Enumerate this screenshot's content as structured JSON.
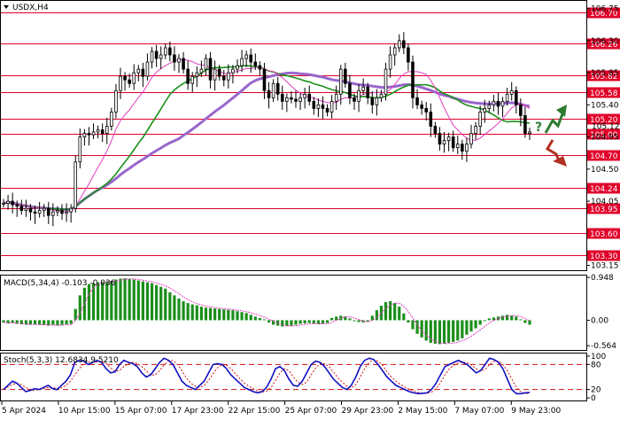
{
  "title": "USDX,H4",
  "chart_data": [
    {
      "panel": "price",
      "type": "candlestick",
      "symbol": "USDX",
      "timeframe": "H4",
      "ylim": [
        103.12,
        106.82
      ],
      "y_ticks": [
        103.15,
        104.05,
        104.5,
        104.95,
        105.4,
        105.85,
        106.3,
        106.75
      ],
      "price_axis_label": "105.12",
      "levels": [
        {
          "value": 106.7,
          "label": "106.70",
          "color": "#e0002a"
        },
        {
          "value": 106.26,
          "label": "106.26",
          "color": "#e0002a"
        },
        {
          "value": 105.82,
          "label": "105.82",
          "color": "#e0002a"
        },
        {
          "value": 105.58,
          "label": "105.58",
          "color": "#e0002a"
        },
        {
          "value": 105.2,
          "label": "105.20",
          "color": "#e0002a"
        },
        {
          "value": 105.0,
          "label": "105.00",
          "color": "#e0002a"
        },
        {
          "value": 104.7,
          "label": "104.70",
          "color": "#e0002a"
        },
        {
          "value": 104.24,
          "label": "104.24",
          "color": "#e0002a"
        },
        {
          "value": 103.95,
          "label": "103.95",
          "color": "#e0002a"
        },
        {
          "value": 103.6,
          "label": "103.60",
          "color": "#e0002a"
        },
        {
          "value": 103.3,
          "label": "103.30",
          "color": "#e0002a"
        }
      ],
      "close_series": [
        104.02,
        104.05,
        104.0,
        103.98,
        103.92,
        103.95,
        103.9,
        103.88,
        103.92,
        103.95,
        103.85,
        103.9,
        103.92,
        103.88,
        103.9,
        103.95,
        104.6,
        104.95,
        105.0,
        104.98,
        105.02,
        105.05,
        105.0,
        105.1,
        105.3,
        105.6,
        105.8,
        105.75,
        105.7,
        105.85,
        105.9,
        105.8,
        106.0,
        106.15,
        106.05,
        106.1,
        106.2,
        106.1,
        106.0,
        106.05,
        105.9,
        105.7,
        105.8,
        105.85,
        105.9,
        106.05,
        105.75,
        105.9,
        105.8,
        105.75,
        105.85,
        105.9,
        105.95,
        106.05,
        106.1,
        106.0,
        105.95,
        105.9,
        105.6,
        105.5,
        105.7,
        105.55,
        105.45,
        105.5,
        105.48,
        105.45,
        105.5,
        105.55,
        105.45,
        105.35,
        105.4,
        105.35,
        105.3,
        105.45,
        105.55,
        105.9,
        105.7,
        105.5,
        105.45,
        105.6,
        105.65,
        105.5,
        105.4,
        105.5,
        105.55,
        105.9,
        106.1,
        106.2,
        106.3,
        106.2,
        106.0,
        105.5,
        105.4,
        105.35,
        105.3,
        105.1,
        105.0,
        104.85,
        104.9,
        104.95,
        104.8,
        104.85,
        104.75,
        104.85,
        105.0,
        105.1,
        105.3,
        105.35,
        105.4,
        105.45,
        105.38,
        105.45,
        105.55,
        105.6,
        105.4,
        105.25,
        105.0,
        105.02
      ],
      "moving_averages": [
        {
          "color": "#9966cc"
        },
        {
          "color": "#1a8f1a"
        },
        {
          "color": "#e040c0"
        }
      ],
      "annotation_up_color": "#2e7d32",
      "annotation_down_color": "#b03020",
      "annotation_question": "?"
    },
    {
      "panel": "macd",
      "type": "bar",
      "label": "MACD(5,34,4) -0.103 -0.036",
      "ylim": [
        -0.6,
        0.95
      ],
      "y_ticks": [
        0.948,
        0.0,
        -0.564
      ],
      "bar_color": "#1a8f1a",
      "signal_color": "#e040c0",
      "values": [
        -0.05,
        -0.07,
        -0.06,
        -0.08,
        -0.09,
        -0.1,
        -0.1,
        -0.09,
        -0.1,
        -0.11,
        -0.12,
        -0.1,
        -0.12,
        -0.1,
        -0.09,
        -0.08,
        0.25,
        0.55,
        0.72,
        0.8,
        0.82,
        0.84,
        0.85,
        0.86,
        0.87,
        0.9,
        0.92,
        0.93,
        0.91,
        0.9,
        0.88,
        0.86,
        0.84,
        0.82,
        0.78,
        0.74,
        0.7,
        0.62,
        0.55,
        0.48,
        0.42,
        0.38,
        0.35,
        0.33,
        0.3,
        0.28,
        0.27,
        0.26,
        0.25,
        0.24,
        0.23,
        0.22,
        0.2,
        0.18,
        0.16,
        0.12,
        0.08,
        0.05,
        0.02,
        -0.05,
        -0.1,
        -0.12,
        -0.14,
        -0.13,
        -0.12,
        -0.1,
        -0.08,
        -0.07,
        -0.06,
        -0.08,
        -0.09,
        -0.08,
        -0.06,
        0.05,
        0.08,
        0.1,
        0.08,
        0.04,
        -0.02,
        -0.04,
        -0.05,
        -0.03,
        0.1,
        0.22,
        0.32,
        0.4,
        0.42,
        0.38,
        0.3,
        0.15,
        -0.05,
        -0.2,
        -0.3,
        -0.38,
        -0.45,
        -0.5,
        -0.52,
        -0.53,
        -0.52,
        -0.5,
        -0.48,
        -0.45,
        -0.4,
        -0.32,
        -0.25,
        -0.18,
        -0.1,
        -0.02,
        0.04,
        0.06,
        0.08,
        0.1,
        0.12,
        0.1,
        0.08,
        0.02,
        -0.06,
        -0.1
      ]
    },
    {
      "panel": "stochastic",
      "type": "line",
      "label": "Stoch(5,3,3) 12.6834 9.5210",
      "ylim": [
        -2,
        102
      ],
      "y_ticks": [
        100,
        80,
        20,
        0
      ],
      "levels": [
        80,
        20
      ],
      "main_color": "#1010c0",
      "signal_color": "#d01010",
      "main_values": [
        20,
        30,
        40,
        35,
        25,
        15,
        18,
        22,
        20,
        25,
        30,
        22,
        20,
        30,
        40,
        55,
        85,
        90,
        88,
        80,
        85,
        90,
        85,
        70,
        60,
        62,
        80,
        90,
        85,
        82,
        75,
        60,
        50,
        55,
        70,
        85,
        95,
        90,
        80,
        60,
        40,
        30,
        25,
        20,
        30,
        40,
        60,
        80,
        82,
        80,
        70,
        55,
        45,
        35,
        25,
        20,
        15,
        12,
        15,
        25,
        45,
        70,
        75,
        65,
        45,
        30,
        28,
        40,
        60,
        80,
        88,
        85,
        75,
        60,
        45,
        35,
        25,
        20,
        30,
        50,
        75,
        90,
        95,
        92,
        80,
        65,
        50,
        40,
        30,
        25,
        20,
        15,
        12,
        10,
        11,
        12,
        20,
        35,
        55,
        75,
        80,
        85,
        90,
        85,
        80,
        70,
        60,
        65,
        80,
        95,
        92,
        85,
        70,
        45,
        20,
        10,
        10,
        12,
        13
      ],
      "signal_values": [
        22,
        26,
        32,
        35,
        32,
        25,
        20,
        18,
        20,
        22,
        25,
        25,
        22,
        24,
        30,
        40,
        55,
        70,
        82,
        86,
        85,
        86,
        87,
        82,
        72,
        64,
        65,
        75,
        82,
        85,
        82,
        75,
        65,
        55,
        55,
        65,
        78,
        88,
        90,
        80,
        65,
        48,
        35,
        28,
        25,
        30,
        42,
        58,
        72,
        80,
        78,
        70,
        58,
        46,
        36,
        28,
        22,
        16,
        14,
        16,
        25,
        42,
        60,
        70,
        65,
        50,
        38,
        32,
        38,
        55,
        72,
        82,
        82,
        75,
        62,
        48,
        38,
        28,
        24,
        32,
        50,
        70,
        85,
        92,
        88,
        78,
        62,
        50,
        40,
        32,
        26,
        20,
        16,
        13,
        11,
        11,
        14,
        22,
        36,
        55,
        70,
        78,
        84,
        86,
        84,
        78,
        70,
        64,
        68,
        80,
        88,
        88,
        80,
        65,
        45,
        25,
        15,
        11,
        10
      ]
    },
    {
      "panel": "time_axis",
      "type": "table",
      "labels": [
        "5 Apr 2024",
        "10 Apr 15:00",
        "15 Apr 07:00",
        "17 Apr 23:00",
        "22 Apr 15:00",
        "25 Apr 07:00",
        "29 Apr 23:00",
        "2 May 15:00",
        "7 May 07:00",
        "9 May 23:00"
      ]
    }
  ]
}
